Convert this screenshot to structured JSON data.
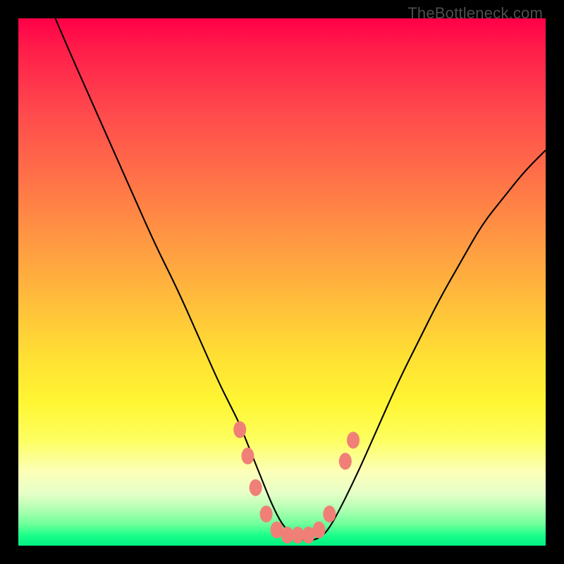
{
  "credit": "TheBottleneck.com",
  "colors": {
    "gradient_top": "#ff0048",
    "gradient_mid": "#ffe233",
    "gradient_bottom": "#00ef82",
    "curve": "#000000",
    "marker": "#f08077",
    "frame": "#000000"
  },
  "chart_data": {
    "type": "line",
    "title": "",
    "xlabel": "",
    "ylabel": "",
    "xlim": [
      0,
      100
    ],
    "ylim": [
      0,
      100
    ],
    "note": "Axes are unlabeled; values estimated from pixel positions on a 0–100 normalized square. Y=0 is bottom (green), Y=100 is top (red).",
    "series": [
      {
        "name": "bottleneck-curve",
        "x": [
          7,
          10,
          14,
          18,
          22,
          26,
          30,
          34,
          38,
          40,
          42,
          44,
          46,
          48,
          50,
          52,
          54,
          56,
          58,
          60,
          64,
          68,
          72,
          76,
          80,
          84,
          88,
          92,
          96,
          100
        ],
        "y": [
          100,
          93,
          84,
          75,
          66,
          57,
          49,
          40,
          31,
          27,
          23,
          18,
          13,
          8,
          4,
          2,
          1,
          1,
          2,
          5,
          13,
          22,
          31,
          39,
          47,
          54,
          61,
          66,
          71,
          75
        ]
      }
    ],
    "markers": {
      "name": "highlight-points",
      "note": "Salmon oval markers near the curve's minimum",
      "points": [
        {
          "x": 42,
          "y": 22
        },
        {
          "x": 43.5,
          "y": 17
        },
        {
          "x": 45,
          "y": 11
        },
        {
          "x": 47,
          "y": 6
        },
        {
          "x": 49,
          "y": 3
        },
        {
          "x": 51,
          "y": 2
        },
        {
          "x": 53,
          "y": 2
        },
        {
          "x": 55,
          "y": 2
        },
        {
          "x": 57,
          "y": 3
        },
        {
          "x": 59,
          "y": 6
        },
        {
          "x": 62,
          "y": 16
        },
        {
          "x": 63.5,
          "y": 20
        }
      ]
    }
  }
}
